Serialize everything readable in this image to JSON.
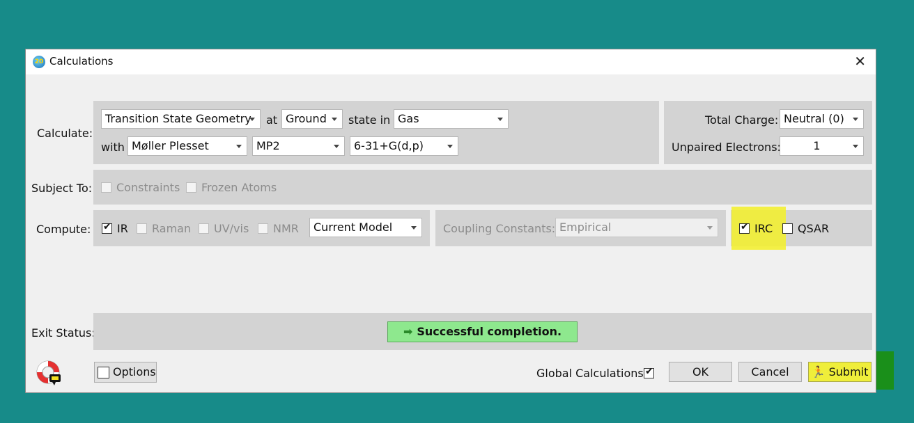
{
  "window": {
    "title": "Calculations",
    "icon_text": "20"
  },
  "calculate": {
    "label": "Calculate:",
    "task": "Transition State Geometry",
    "at_label": "at",
    "state": "Ground",
    "state_in_label": "state in",
    "medium": "Gas",
    "with_label": "with",
    "method": "Møller Plesset",
    "level": "MP2",
    "basis": "6-31+G(d,p)",
    "total_charge_label": "Total Charge:",
    "total_charge": "Neutral (0)",
    "unpaired_label": "Unpaired Electrons:",
    "unpaired": "1"
  },
  "subject_to": {
    "label": "Subject To:",
    "constraints": {
      "label": "Constraints",
      "checked": false
    },
    "frozen_atoms": {
      "label": "Frozen Atoms",
      "checked": false
    }
  },
  "compute": {
    "label": "Compute:",
    "ir": {
      "label": "IR",
      "checked": true
    },
    "raman": {
      "label": "Raman",
      "checked": false
    },
    "uvvis": {
      "label": "UV/vis",
      "checked": false
    },
    "nmr": {
      "label": "NMR",
      "checked": false
    },
    "model": "Current Model",
    "coupling_label": "Coupling Constants:",
    "coupling_value": "Empirical",
    "irc": {
      "label": "IRC",
      "checked": true
    },
    "qsar": {
      "label": "QSAR",
      "checked": false
    }
  },
  "exit_status": {
    "label": "Exit Status:",
    "message": "Successful completion."
  },
  "footer": {
    "options_label": "Options",
    "global_label": "Global Calculations",
    "global_checked": true,
    "ok_label": "OK",
    "cancel_label": "Cancel",
    "submit_label": "Submit"
  },
  "colors": {
    "desktop": "#178b89",
    "status_success": "#8ee88e",
    "highlight": "#f3f028",
    "submit_backdrop": "#1a8f1a"
  }
}
